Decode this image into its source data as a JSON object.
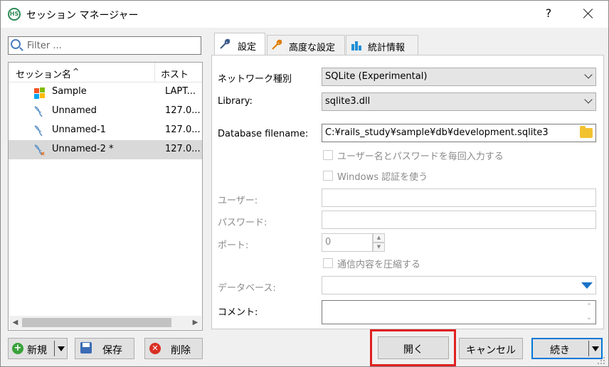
{
  "window": {
    "title": "セッション マネージャー",
    "app_icon_text": "HS",
    "help_label": "?"
  },
  "filter": {
    "placeholder": "Filter ..."
  },
  "session_list": {
    "columns": {
      "name": "セッション名",
      "host": "ホスト"
    },
    "sort_indicator": "^",
    "rows": [
      {
        "name": "Sample",
        "host": "LAPT...",
        "icon": "windows-icon"
      },
      {
        "name": "Unnamed",
        "host": "127.0...",
        "icon": "sqlite-icon"
      },
      {
        "name": "Unnamed-1",
        "host": "127.0...",
        "icon": "sqlite-icon"
      },
      {
        "name": "Unnamed-2 *",
        "host": "127.0...",
        "icon": "sqlite-icon",
        "selected": true
      }
    ]
  },
  "left_buttons": {
    "new_label": "新規",
    "save_label": "保存",
    "delete_label": "削除"
  },
  "tabs": [
    {
      "label": "設定",
      "icon": "wrench-icon",
      "active": true
    },
    {
      "label": "高度な設定",
      "icon": "wrench-orange-icon"
    },
    {
      "label": "統計情報",
      "icon": "bar-chart-icon"
    }
  ],
  "settings": {
    "network_type_label": "ネットワーク種別",
    "network_type_value": "SQLite (Experimental)",
    "library_label": "Library:",
    "library_value": "sqlite3.dll",
    "db_filename_label": "Database filename:",
    "db_filename_value": "C:¥rails_study¥sample¥db¥development.sqlite3",
    "prompt_credentials_label": "ユーザー名とパスワードを毎回入力する",
    "windows_auth_label": "Windows 認証を使う",
    "user_label": "ユーザー:",
    "user_value": "",
    "password_label": "パスワード:",
    "password_value": "",
    "port_label": "ポート:",
    "port_value": "0",
    "compress_label": "通信内容を圧縮する",
    "database_label": "データベース:",
    "database_value": "",
    "comment_label": "コメント:",
    "comment_value": ""
  },
  "right_buttons": {
    "open_label": "開く",
    "cancel_label": "キャンセル",
    "continue_label": "続き"
  },
  "colors": {
    "accent": "#0078d7",
    "highlight": "#e02020",
    "selected_row": "#d9d9d9"
  }
}
